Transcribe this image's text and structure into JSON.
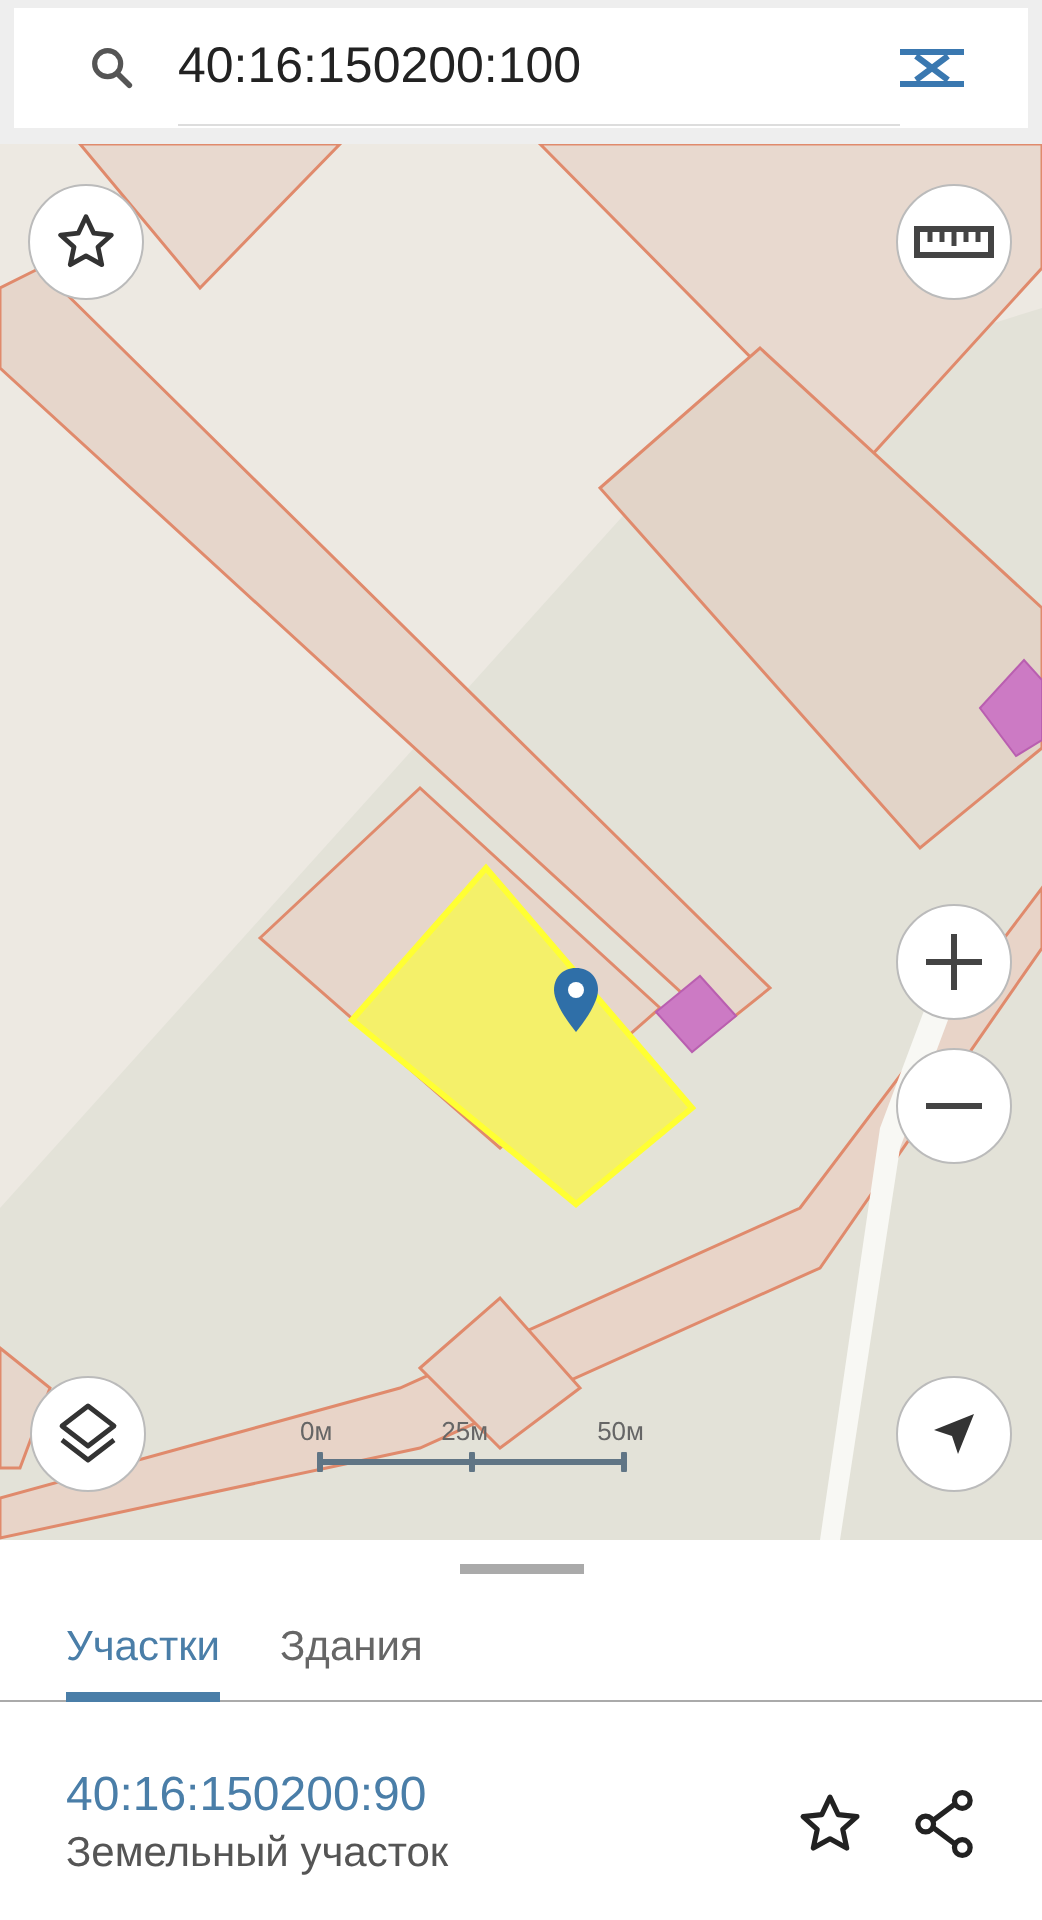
{
  "search": {
    "value": "40:16:150200:100"
  },
  "scale_bar": {
    "labels": [
      "0м",
      "25м",
      "50м"
    ]
  },
  "tabs": [
    {
      "label": "Участки",
      "selected": true
    },
    {
      "label": "Здания",
      "selected": false
    }
  ],
  "result": {
    "title": "40:16:150200:90",
    "subtitle": "Земельный участок"
  }
}
